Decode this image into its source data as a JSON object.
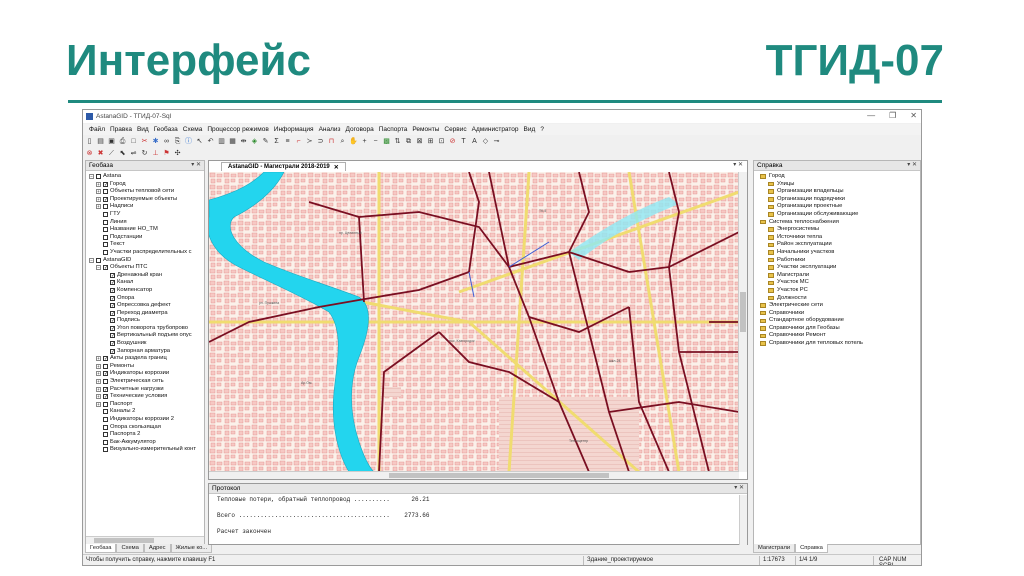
{
  "slide": {
    "title": "Интерфейс",
    "code": "ТГИД-07"
  },
  "window": {
    "title": "AstanaGID - ТГИД-07-Sql",
    "controls": [
      "—",
      "❐",
      "✕"
    ]
  },
  "menu": [
    "Файл",
    "Правка",
    "Вид",
    "Геобаза",
    "Схема",
    "Процессор режимов",
    "Информация",
    "Анализ",
    "Договора",
    "Паспорта",
    "Ремонты",
    "Сервис",
    "Администратор",
    "Вид",
    "?"
  ],
  "geobase": {
    "title": "Геобаза",
    "tree": [
      {
        "level": 0,
        "exp": "−",
        "checked": false,
        "label": "Astana"
      },
      {
        "level": 1,
        "exp": "+",
        "checked": true,
        "label": "Город"
      },
      {
        "level": 1,
        "exp": "+",
        "checked": false,
        "label": "Объекты тепловой сети"
      },
      {
        "level": 1,
        "exp": "+",
        "checked": true,
        "label": "Проектируемые объекты"
      },
      {
        "level": 1,
        "exp": "+",
        "checked": false,
        "label": "Надписи"
      },
      {
        "level": 1,
        "exp": "",
        "checked": false,
        "label": "ГТУ"
      },
      {
        "level": 1,
        "exp": "",
        "checked": false,
        "label": "Линия"
      },
      {
        "level": 1,
        "exp": "",
        "checked": false,
        "label": "Название НО_ТМ"
      },
      {
        "level": 1,
        "exp": "",
        "checked": false,
        "label": "Подстанции"
      },
      {
        "level": 1,
        "exp": "",
        "checked": false,
        "label": "Текст"
      },
      {
        "level": 1,
        "exp": "",
        "checked": false,
        "label": "Участки распределительных с"
      },
      {
        "level": 0,
        "exp": "−",
        "checked": false,
        "label": "AstanaGID"
      },
      {
        "level": 1,
        "exp": "−",
        "checked": true,
        "label": "Объекты ПТС"
      },
      {
        "level": 2,
        "exp": "",
        "checked": true,
        "label": "Дренажный кран"
      },
      {
        "level": 2,
        "exp": "",
        "checked": true,
        "label": "Канал"
      },
      {
        "level": 2,
        "exp": "",
        "checked": true,
        "label": "Компенсатор"
      },
      {
        "level": 2,
        "exp": "",
        "checked": true,
        "label": "Опора"
      },
      {
        "level": 2,
        "exp": "",
        "checked": true,
        "label": "Опрессовка дефект"
      },
      {
        "level": 2,
        "exp": "",
        "checked": true,
        "label": "Переход диаметра"
      },
      {
        "level": 2,
        "exp": "",
        "checked": true,
        "label": "Подпись"
      },
      {
        "level": 2,
        "exp": "",
        "checked": true,
        "label": "Угол поворота трубопрово"
      },
      {
        "level": 2,
        "exp": "",
        "checked": true,
        "label": "Вертикальный подъем опус"
      },
      {
        "level": 2,
        "exp": "",
        "checked": true,
        "label": "Воздушник"
      },
      {
        "level": 2,
        "exp": "",
        "checked": true,
        "label": "Запорная арматура"
      },
      {
        "level": 1,
        "exp": "+",
        "checked": true,
        "label": "Акты раздела границ"
      },
      {
        "level": 1,
        "exp": "+",
        "checked": false,
        "label": "Ремонты"
      },
      {
        "level": 1,
        "exp": "+",
        "checked": true,
        "label": "Индикаторы коррозии"
      },
      {
        "level": 1,
        "exp": "+",
        "checked": false,
        "label": "Электрическая сеть"
      },
      {
        "level": 1,
        "exp": "+",
        "checked": true,
        "label": "Расчетные нагрузки"
      },
      {
        "level": 1,
        "exp": "+",
        "checked": true,
        "label": "Технические условия"
      },
      {
        "level": 1,
        "exp": "+",
        "checked": false,
        "label": "Паспорт"
      },
      {
        "level": 1,
        "exp": "",
        "checked": false,
        "label": "Каналы 2"
      },
      {
        "level": 1,
        "exp": "",
        "checked": false,
        "label": "Индикаторы коррозии 2"
      },
      {
        "level": 1,
        "exp": "",
        "checked": false,
        "label": "Опора скользящая"
      },
      {
        "level": 1,
        "exp": "",
        "checked": false,
        "label": "Паспорта 2"
      },
      {
        "level": 1,
        "exp": "",
        "checked": false,
        "label": "Бак-Аккумулятор"
      },
      {
        "level": 1,
        "exp": "",
        "checked": false,
        "label": "Визуально-измерительный конт"
      }
    ],
    "tabs": [
      "Геобаза",
      "Схема",
      "Адрес",
      "Жилые ко..."
    ]
  },
  "map": {
    "tab_title": "AstanaGID - Магистрали 2018-2019",
    "tab_close": "✕"
  },
  "protocol": {
    "title": "Протокол",
    "lines": [
      "Тепловые потери, обратный теплопровод ..........      26.21",
      "",
      "Всего ..........................................    2773.66",
      "",
      "Расчет закончен"
    ]
  },
  "help": {
    "title": "Справка",
    "tree": [
      {
        "level": 0,
        "label": "Город"
      },
      {
        "level": 1,
        "label": "Улицы"
      },
      {
        "level": 1,
        "label": "Организации владельцы"
      },
      {
        "level": 1,
        "label": "Организации подрядчики"
      },
      {
        "level": 1,
        "label": "Организации проектные"
      },
      {
        "level": 1,
        "label": "Организации обслуживающие"
      },
      {
        "level": 0,
        "label": "Система теплоснабжения"
      },
      {
        "level": 1,
        "label": "Энергосистемы"
      },
      {
        "level": 1,
        "label": "Источники тепла"
      },
      {
        "level": 1,
        "label": "Район эксплуатации"
      },
      {
        "level": 1,
        "label": "Начальники участков"
      },
      {
        "level": 1,
        "label": "Работники"
      },
      {
        "level": 1,
        "label": "Участки эксплуатации"
      },
      {
        "level": 1,
        "label": "Магистрали"
      },
      {
        "level": 1,
        "label": "Участок МС"
      },
      {
        "level": 1,
        "label": "Участок РС"
      },
      {
        "level": 1,
        "label": "Должности"
      },
      {
        "level": 0,
        "label": "Электрические сети"
      },
      {
        "level": 0,
        "label": "Справочники"
      },
      {
        "level": 0,
        "label": "Стандартное оборудование"
      },
      {
        "level": 0,
        "label": "Справочники для Геобазы"
      },
      {
        "level": 0,
        "label": "Справочники Ремонт"
      },
      {
        "level": 0,
        "label": "Справочники для тепловых потель"
      }
    ],
    "tabs": [
      "Магистрали",
      "Справка"
    ]
  },
  "status": {
    "hint": "Чтобы получить справку, нажмите клавишу F1",
    "object": "Здание_проектируемое",
    "scale": "1:17673",
    "page": "1/4 1/9",
    "keys": "CAP NUM SCRL"
  },
  "colors": {
    "accent": "#1f8a7f",
    "river": "#23d5ee",
    "pipe": "#7a0f22",
    "road": "#f5e07a"
  }
}
